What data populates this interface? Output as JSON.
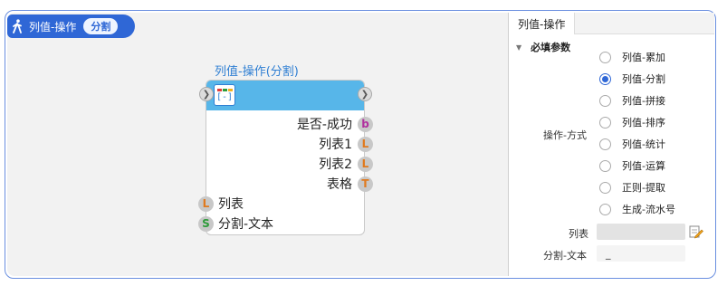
{
  "header": {
    "title": "列值-操作",
    "pill": "分割"
  },
  "node": {
    "title": "列值-操作(分割)",
    "outputs": [
      {
        "label": "是否-成功",
        "type": "b",
        "color": "#b1309e"
      },
      {
        "label": "列表1",
        "type": "L",
        "color": "#e07a1f"
      },
      {
        "label": "列表2",
        "type": "L",
        "color": "#e07a1f"
      },
      {
        "label": "表格",
        "type": "T",
        "color": "#e07a1f"
      }
    ],
    "inputs": [
      {
        "label": "列表",
        "type": "L",
        "color": "#e07a1f"
      },
      {
        "label": "分割-文本",
        "type": "S",
        "color": "#2e9b3a"
      }
    ]
  },
  "panel": {
    "tab": "列值-操作",
    "section": "必填参数",
    "operation_label": "操作-方式",
    "options": [
      "列值-累加",
      "列值-分割",
      "列值-拼接",
      "列值-排序",
      "列值-统计",
      "列值-运算",
      "正则-提取",
      "生成-流水号"
    ],
    "selected_index": 1,
    "list_label": "列表",
    "list_value": "",
    "split_label": "分割-文本",
    "split_value": "_"
  }
}
